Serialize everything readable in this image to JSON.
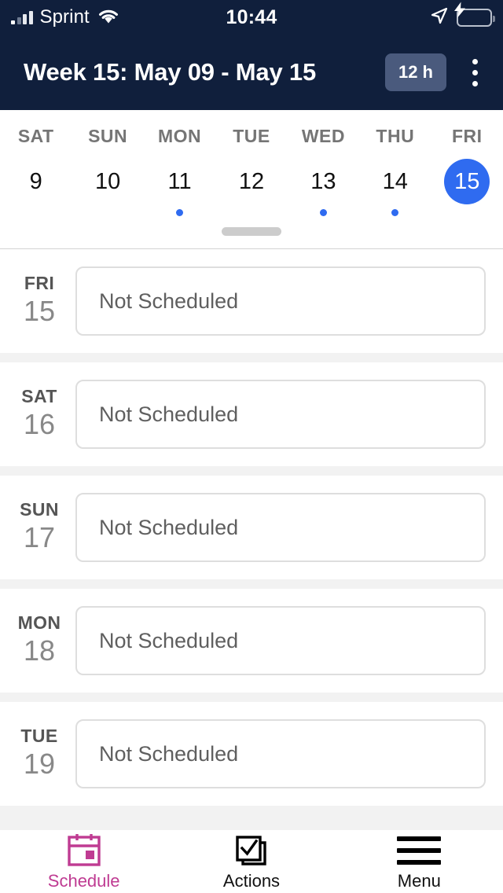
{
  "status_bar": {
    "carrier": "Sprint",
    "time": "10:44",
    "signal_icon": "signal-bars-icon",
    "wifi_icon": "wifi-icon",
    "location_icon": "location-arrow-icon",
    "battery_icon": "battery-charging-icon",
    "battery_color": "#49d14f"
  },
  "header": {
    "title": "Week 15: May 09 - May 15",
    "hours_badge": "12 h",
    "overflow_icon": "kebab-menu-icon",
    "background_color": "#101f3c"
  },
  "week_strip": {
    "accent_color": "#2f6bf0",
    "days": [
      {
        "dow": "SAT",
        "num": "9",
        "has_dot": false,
        "selected": false
      },
      {
        "dow": "SUN",
        "num": "10",
        "has_dot": false,
        "selected": false
      },
      {
        "dow": "MON",
        "num": "11",
        "has_dot": true,
        "selected": false
      },
      {
        "dow": "TUE",
        "num": "12",
        "has_dot": false,
        "selected": false
      },
      {
        "dow": "WED",
        "num": "13",
        "has_dot": true,
        "selected": false
      },
      {
        "dow": "THU",
        "num": "14",
        "has_dot": true,
        "selected": false
      },
      {
        "dow": "FRI",
        "num": "15",
        "has_dot": false,
        "selected": true
      }
    ],
    "grabber_icon": "drag-handle-icon"
  },
  "schedule": {
    "rows": [
      {
        "dow": "FRI",
        "num": "15",
        "status": "Not Scheduled"
      },
      {
        "dow": "SAT",
        "num": "16",
        "status": "Not Scheduled"
      },
      {
        "dow": "SUN",
        "num": "17",
        "status": "Not Scheduled"
      },
      {
        "dow": "MON",
        "num": "18",
        "status": "Not Scheduled"
      },
      {
        "dow": "TUE",
        "num": "19",
        "status": "Not Scheduled"
      }
    ]
  },
  "bottom_nav": {
    "active_color": "#bf3b92",
    "items": [
      {
        "label": "Schedule",
        "icon": "calendar-icon",
        "active": true
      },
      {
        "label": "Actions",
        "icon": "checkbox-stack-icon",
        "active": false
      },
      {
        "label": "Menu",
        "icon": "hamburger-menu-icon",
        "active": false
      }
    ]
  }
}
